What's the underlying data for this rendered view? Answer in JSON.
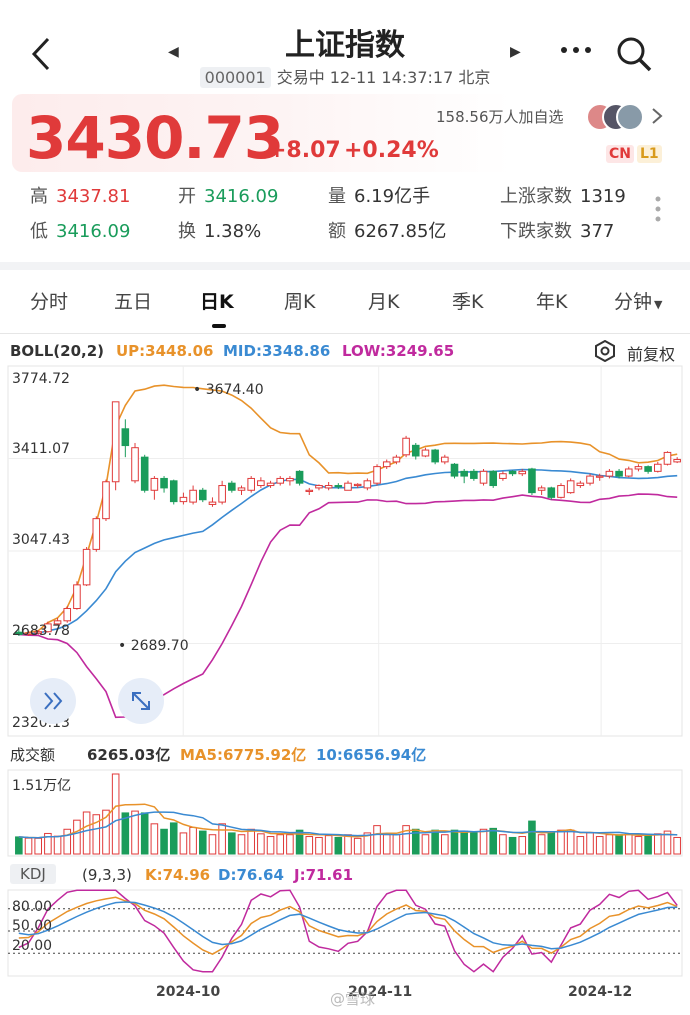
{
  "header": {
    "title": "上证指数",
    "code": "000001",
    "status": "交易中 12-11 14:37:17 北京"
  },
  "quote": {
    "price": "3430.73",
    "change": "+8.07",
    "change_pct": "+0.24%",
    "followers": "158.56万人加自选",
    "badge_cn": "CN",
    "badge_l1": "L1"
  },
  "stats": {
    "high_label": "高",
    "high": "3437.81",
    "open_label": "开",
    "open": "3416.09",
    "volume_label": "量",
    "volume": "6.19亿手",
    "up_label": "上涨家数",
    "up_count": "1319",
    "low_label": "低",
    "low": "3416.09",
    "turnover_label": "换",
    "turnover": "1.38%",
    "amount_label": "额",
    "amount": "6267.85亿",
    "down_label": "下跌家数",
    "down_count": "377"
  },
  "tabs": [
    "分时",
    "五日",
    "日K",
    "周K",
    "月K",
    "季K",
    "年K",
    "分钟"
  ],
  "active_tab": "日K",
  "boll": {
    "name": "BOLL(20,2)",
    "up": "UP:3448.06",
    "mid": "MID:3348.86",
    "low": "LOW:3249.65",
    "adjust": "前复权"
  },
  "kline_axis": {
    "y1": "3774.72",
    "y2": "3411.07",
    "y3": "3047.43",
    "y4": "2683.78",
    "y5": "2320.13",
    "max_label": "3674.40",
    "min_label": "2689.70"
  },
  "volume": {
    "title": "成交额",
    "value": "6265.03亿",
    "ma5": "MA5:6775.92亿",
    "ma10": "10:6656.94亿",
    "max": "1.51万亿"
  },
  "kdj": {
    "name": "KDJ",
    "params": "(9,3,3)",
    "k": "K:74.96",
    "d": "D:76.64",
    "j": "J:71.61",
    "levels": [
      "80.00",
      "50.00",
      "20.00"
    ]
  },
  "dates": [
    "2024-10",
    "2024-11",
    "2024-12"
  ],
  "watermark": "@雪球",
  "colors": {
    "up": "#e03a3a",
    "down": "#1a9c5b",
    "boll_up": "#e8922a",
    "boll_mid": "#3a8ad2",
    "boll_low": "#c02a9e"
  },
  "chart_data": {
    "type": "candlestick",
    "ylim": [
      2320.13,
      3774.72
    ],
    "x_labels": [
      "2024-10",
      "2024-11",
      "2024-12"
    ],
    "candles": [
      [
        2700,
        2690,
        2712,
        2684
      ],
      [
        2690,
        2696,
        2705,
        2684
      ],
      [
        2696,
        2702,
        2710,
        2690
      ],
      [
        2702,
        2735,
        2745,
        2698
      ],
      [
        2735,
        2748,
        2760,
        2728
      ],
      [
        2748,
        2800,
        2810,
        2740
      ],
      [
        2800,
        2900,
        2915,
        2795
      ],
      [
        2900,
        3050,
        3060,
        2895
      ],
      [
        3050,
        3180,
        3190,
        3040
      ],
      [
        3180,
        3336,
        3345,
        3170
      ],
      [
        3336,
        3674,
        3674,
        3300
      ],
      [
        3560,
        3489,
        3600,
        3440
      ],
      [
        3340,
        3480,
        3500,
        3330
      ],
      [
        3440,
        3300,
        3450,
        3290
      ],
      [
        3300,
        3350,
        3360,
        3260
      ],
      [
        3350,
        3310,
        3360,
        3290
      ],
      [
        3340,
        3252,
        3345,
        3240
      ],
      [
        3252,
        3270,
        3290,
        3240
      ],
      [
        3250,
        3300,
        3320,
        3240
      ],
      [
        3300,
        3260,
        3310,
        3250
      ],
      [
        3240,
        3250,
        3270,
        3230
      ],
      [
        3250,
        3320,
        3340,
        3240
      ],
      [
        3330,
        3300,
        3340,
        3290
      ],
      [
        3300,
        3310,
        3320,
        3280
      ],
      [
        3300,
        3350,
        3360,
        3290
      ],
      [
        3320,
        3340,
        3355,
        3310
      ],
      [
        3320,
        3330,
        3340,
        3310
      ],
      [
        3330,
        3350,
        3360,
        3320
      ],
      [
        3340,
        3350,
        3360,
        3320
      ],
      [
        3380,
        3330,
        3385,
        3320
      ],
      [
        3300,
        3300,
        3310,
        3280
      ],
      [
        3310,
        3320,
        3325,
        3300
      ],
      [
        3310,
        3320,
        3335,
        3300
      ],
      [
        3320,
        3315,
        3330,
        3305
      ],
      [
        3300,
        3330,
        3340,
        3300
      ],
      [
        3320,
        3325,
        3330,
        3310
      ],
      [
        3310,
        3340,
        3350,
        3300
      ],
      [
        3330,
        3400,
        3410,
        3320
      ],
      [
        3400,
        3420,
        3430,
        3390
      ],
      [
        3420,
        3440,
        3450,
        3410
      ],
      [
        3450,
        3520,
        3530,
        3440
      ],
      [
        3490,
        3445,
        3500,
        3430
      ],
      [
        3445,
        3470,
        3480,
        3440
      ],
      [
        3470,
        3420,
        3475,
        3410
      ],
      [
        3420,
        3440,
        3450,
        3410
      ],
      [
        3410,
        3360,
        3415,
        3350
      ],
      [
        3380,
        3360,
        3390,
        3330
      ],
      [
        3380,
        3350,
        3390,
        3340
      ],
      [
        3330,
        3380,
        3390,
        3320
      ],
      [
        3380,
        3320,
        3385,
        3310
      ],
      [
        3350,
        3370,
        3380,
        3340
      ],
      [
        3380,
        3370,
        3385,
        3360
      ],
      [
        3370,
        3380,
        3390,
        3360
      ],
      [
        3390,
        3290,
        3395,
        3280
      ],
      [
        3300,
        3310,
        3320,
        3280
      ],
      [
        3310,
        3270,
        3315,
        3260
      ],
      [
        3270,
        3320,
        3330,
        3265
      ],
      [
        3290,
        3340,
        3350,
        3285
      ],
      [
        3320,
        3330,
        3340,
        3310
      ],
      [
        3330,
        3360,
        3370,
        3320
      ],
      [
        3360,
        3360,
        3370,
        3340
      ],
      [
        3360,
        3380,
        3390,
        3350
      ],
      [
        3380,
        3360,
        3390,
        3350
      ],
      [
        3360,
        3390,
        3400,
        3355
      ],
      [
        3390,
        3400,
        3410,
        3380
      ],
      [
        3400,
        3380,
        3405,
        3370
      ],
      [
        3380,
        3410,
        3420,
        3375
      ],
      [
        3410,
        3460,
        3465,
        3405
      ],
      [
        3420,
        3430,
        3440,
        3415
      ]
    ],
    "volume_max": "1.51万亿"
  }
}
